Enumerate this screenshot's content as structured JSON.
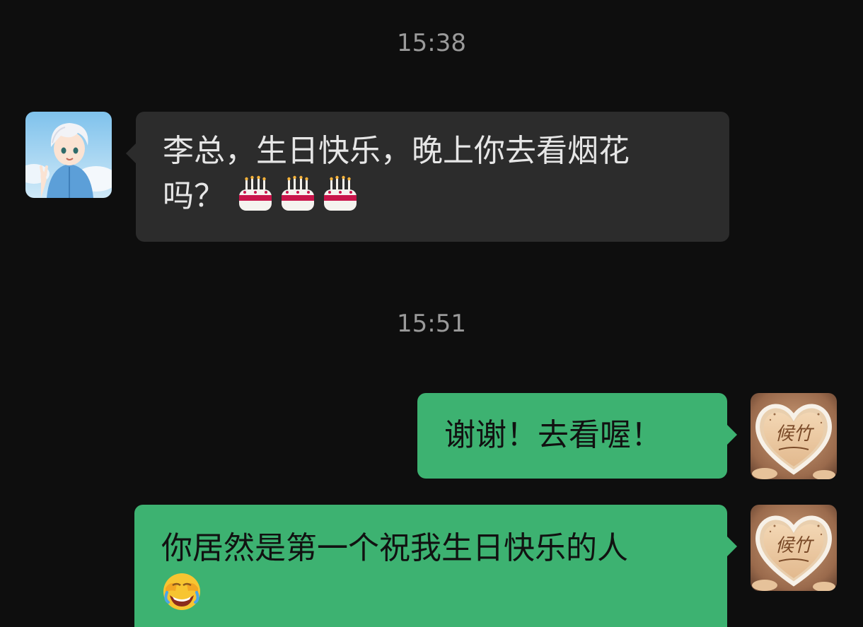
{
  "chat": {
    "timestamps": [
      "15:38",
      "15:51"
    ],
    "messages": [
      {
        "sender": "other",
        "text_line1": "李总，生日快乐，晚上你去看烟花",
        "text_line2": "吗？",
        "emojis": [
          "birthday-cake",
          "birthday-cake",
          "birthday-cake"
        ]
      },
      {
        "sender": "me",
        "text": "谢谢！去看喔！"
      },
      {
        "sender": "me",
        "text_line1": "你居然是第一个祝我生日快乐的人",
        "emojis": [
          "face-with-tears-of-joy-covering-face"
        ]
      }
    ],
    "avatar_right_text": "候竹",
    "colors": {
      "background": "#0e0e0e",
      "incoming_bubble": "#2c2c2c",
      "outgoing_bubble": "#3db271",
      "timestamp": "#9a9a9a"
    }
  }
}
